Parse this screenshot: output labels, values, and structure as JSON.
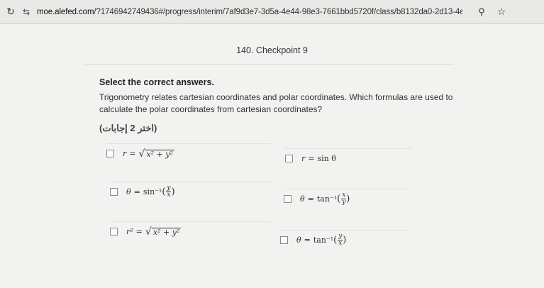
{
  "browser": {
    "url_host": "moe.alefed.com",
    "url_path": "/?1746942749436#/progress/interim/7af9d3e7-3d5a-4e44-98e3-7661bbd5720f/class/b8132da0-2d13-4ee3-9cb0-ac06d7955988...",
    "reload_icon": "reload-icon",
    "site_info_icon": "site-info-icon",
    "zoom_icon": "search-icon",
    "bookmark_icon": "star-icon"
  },
  "header": {
    "checkpoint_title": "140. Checkpoint 9"
  },
  "question": {
    "instruction": "Select the correct answers.",
    "prompt": "Trigonometry relates cartesian coordinates and polar coordinates. Which formulas are used to calculate the polar coordinates from cartesian coordinates?",
    "arabic_label": "(اختر 2 إجابات)"
  },
  "options": [
    {
      "id": "opt1",
      "text": "r = √(x² + y²)",
      "lhs": "r",
      "eq": "=",
      "content": "x² + y²"
    },
    {
      "id": "opt2",
      "text": "r = sin θ",
      "lhs": "r",
      "eq": "=",
      "content": "sin θ"
    },
    {
      "id": "opt3",
      "text": "θ = sin⁻¹(y/x)",
      "lhs": "θ",
      "eq": "=",
      "fn": "sin⁻¹",
      "num": "y",
      "den": "x"
    },
    {
      "id": "opt4",
      "text": "θ = tan⁻¹(x/y)",
      "lhs": "θ",
      "eq": "=",
      "fn": "tan⁻¹",
      "num": "x",
      "den": "y"
    },
    {
      "id": "opt5",
      "text": "r² = √(x² + y²)",
      "lhs": "r²",
      "eq": "=",
      "content": "x² + y²"
    },
    {
      "id": "opt6",
      "text": "θ = tan⁻¹(y/x)",
      "lhs": "θ",
      "eq": "=",
      "fn": "tan⁻¹",
      "num": "y",
      "den": "x"
    }
  ],
  "colors": {
    "background": "#f2f2f0",
    "text": "#2a2a2a",
    "border": "#8a8a8a"
  }
}
